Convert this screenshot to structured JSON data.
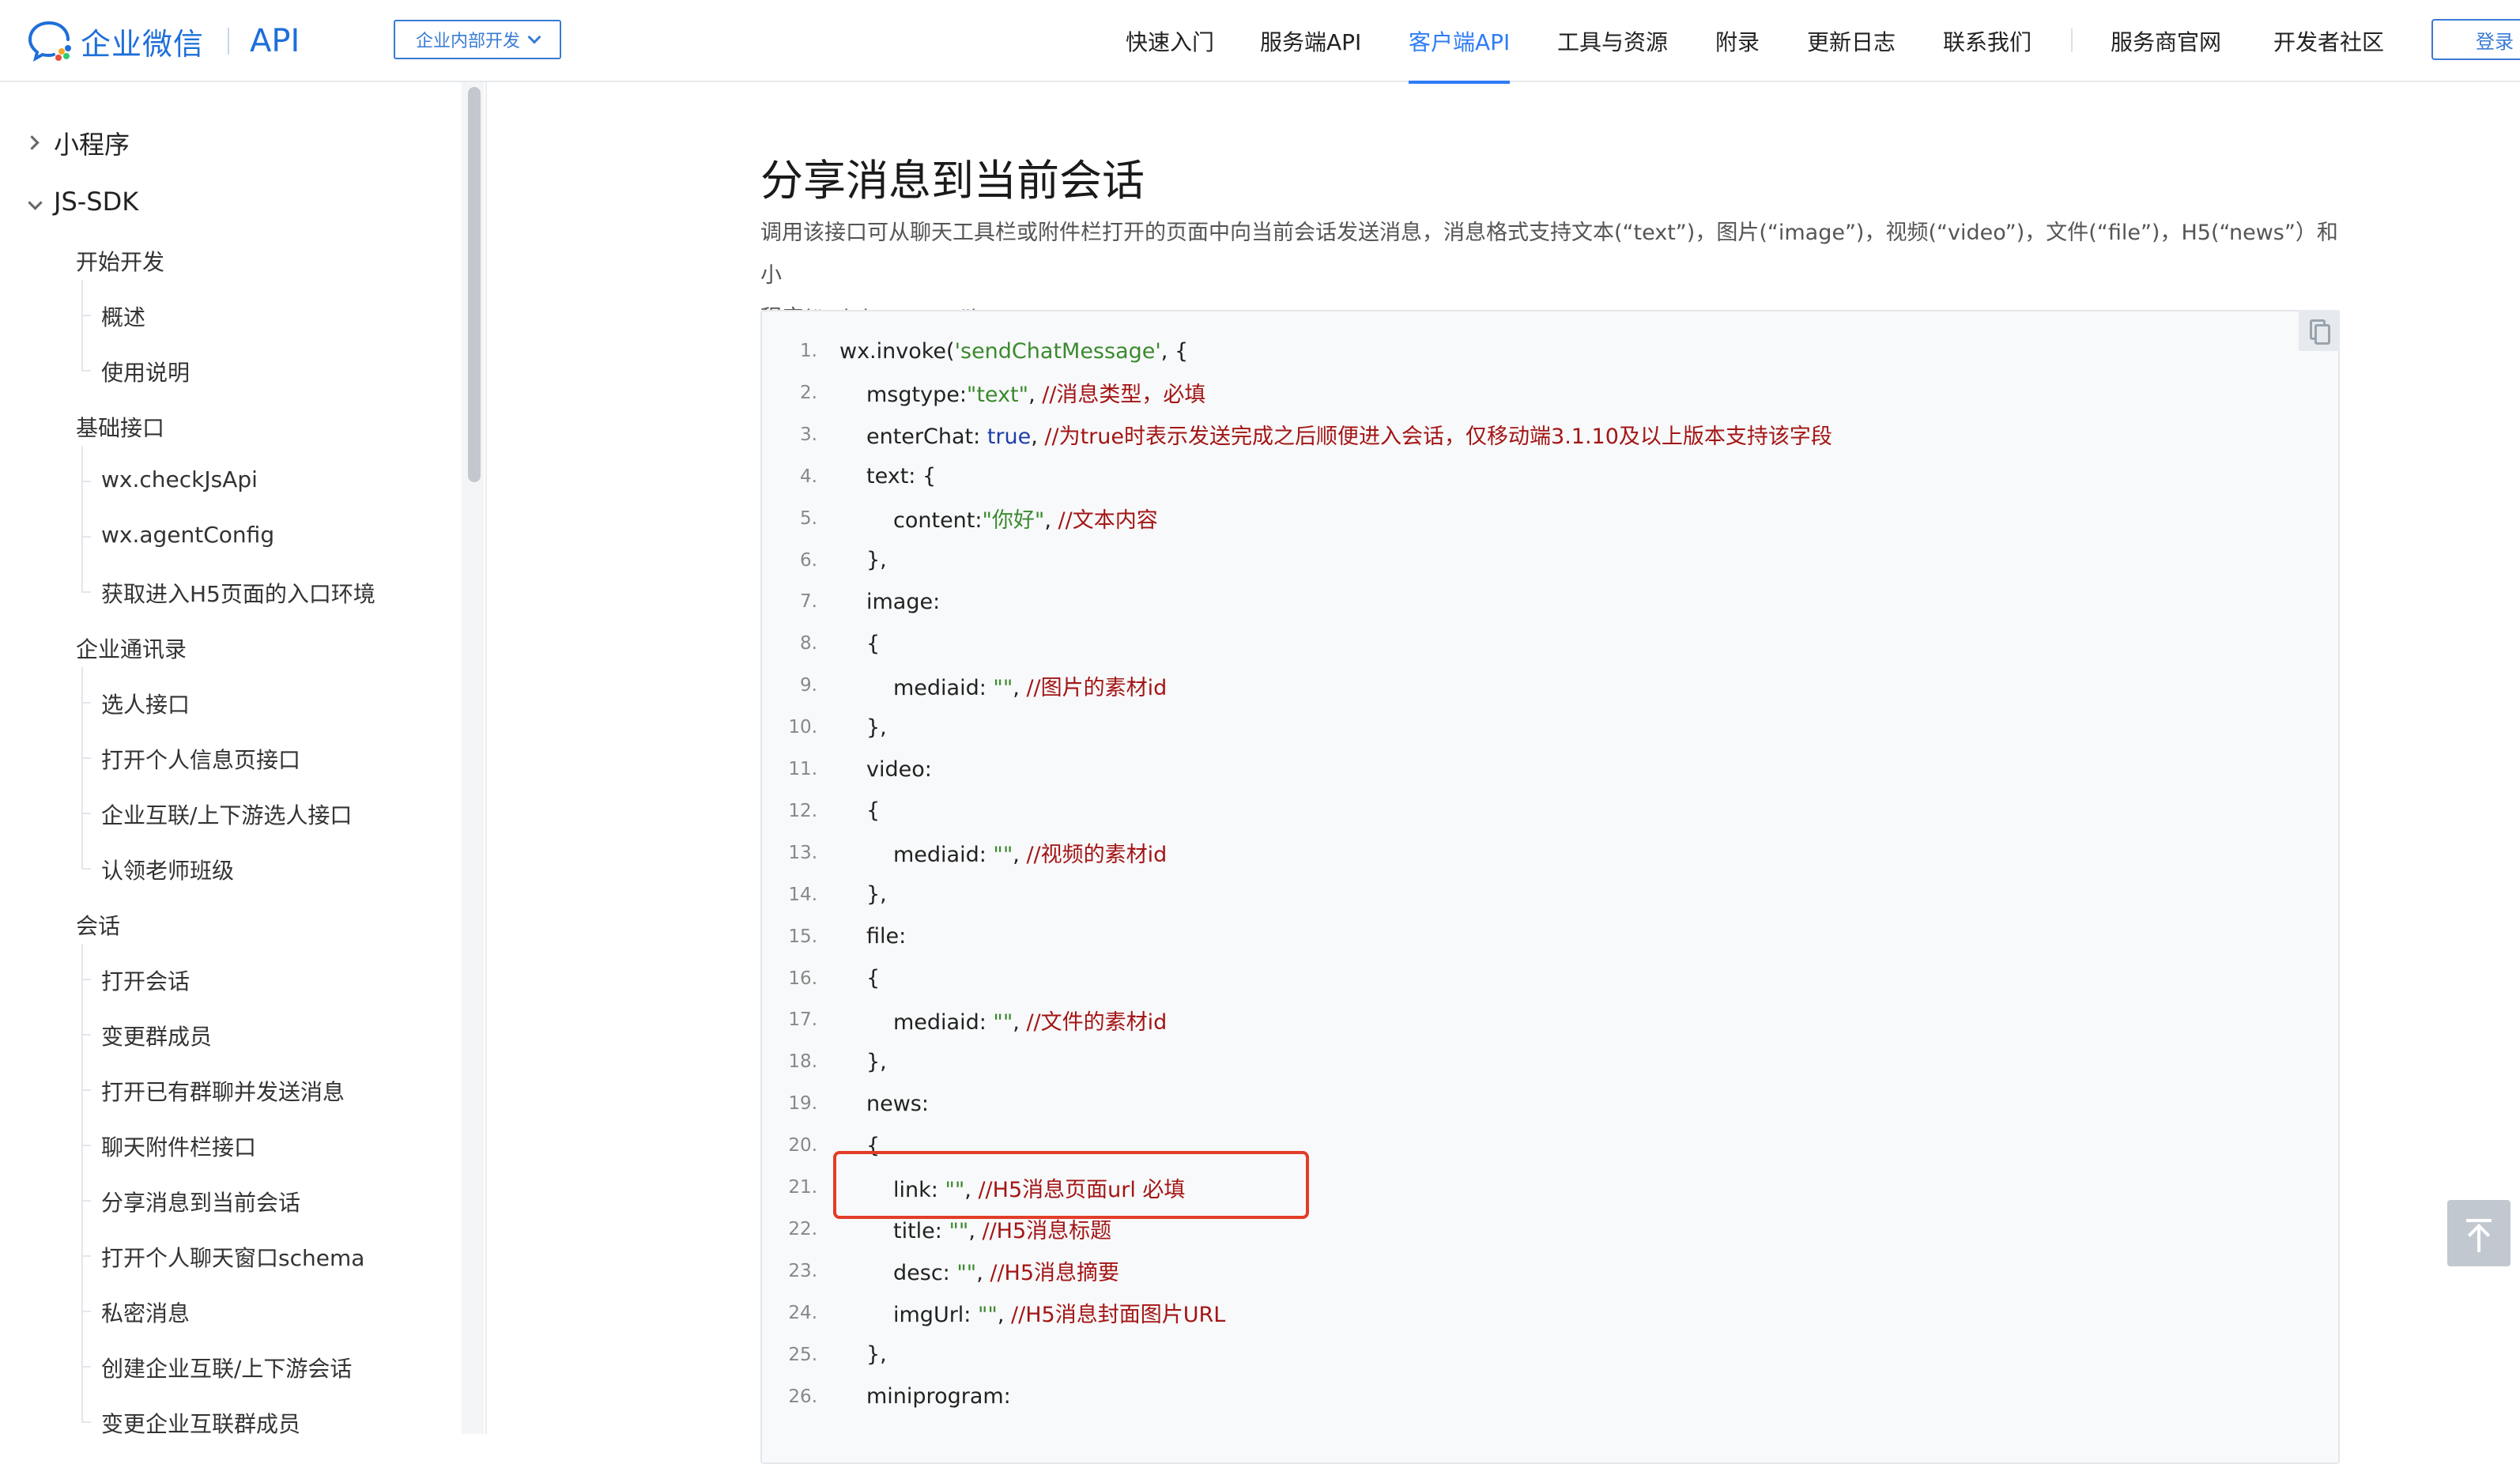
{
  "header": {
    "logo_text": "企业微信",
    "logo_api": "API",
    "dev_select": "企业内部开发",
    "nav": [
      {
        "label": "快速入门"
      },
      {
        "label": "服务端API"
      },
      {
        "label": "客户端API",
        "active": true
      },
      {
        "label": "工具与资源"
      },
      {
        "label": "附录"
      },
      {
        "label": "更新日志"
      },
      {
        "label": "联系我们"
      },
      {
        "label": "服务商官网"
      },
      {
        "label": "开发者社区"
      }
    ],
    "login": "登录",
    "accent_color": "#2f7cf6"
  },
  "sidebar": {
    "top": [
      {
        "label": "小程序",
        "expanded": false
      },
      {
        "label": "JS-SDK",
        "expanded": true
      }
    ],
    "groups": [
      {
        "label": "开始开发",
        "items": [
          "概述",
          "使用说明"
        ]
      },
      {
        "label": "基础接口",
        "items": [
          "wx.checkJsApi",
          "wx.agentConfig",
          "获取进入H5页面的入口环境"
        ]
      },
      {
        "label": "企业通讯录",
        "items": [
          "选人接口",
          "打开个人信息页接口",
          "企业互联/上下游选人接口",
          "认领老师班级"
        ]
      },
      {
        "label": "会话",
        "items": [
          "打开会话",
          "变更群成员",
          "打开已有群聊并发送消息",
          "聊天附件栏接口",
          "分享消息到当前会话",
          "打开个人聊天窗口schema",
          "私密消息",
          "创建企业互联/上下游会话",
          "变更企业互联群成员"
        ]
      }
    ]
  },
  "main": {
    "title": "分享消息到当前会话",
    "desc_line1": "调用该接口可从聊天工具栏或附件栏打开的页面中向当前会话发送消息，消息格式支持文本(“text”)，图片(“image”)，视频(“video”)，文件(“file”)，H5(“news”）和小",
    "desc_line2": "程序(“miniprogram”)"
  },
  "code": [
    {
      "n": "1.",
      "indent": 0,
      "parts": [
        [
          "k",
          "wx.invoke("
        ],
        [
          "s",
          "'sendChatMessage'"
        ],
        [
          "p",
          ", {"
        ]
      ]
    },
    {
      "n": "2.",
      "indent": 1,
      "parts": [
        [
          "k",
          "msgtype:"
        ],
        [
          "s",
          "\"text\""
        ],
        [
          "p",
          ", "
        ],
        [
          "c",
          "//消息类型，必填"
        ]
      ]
    },
    {
      "n": "3.",
      "indent": 1,
      "parts": [
        [
          "k",
          "enterChat: "
        ],
        [
          "b",
          "true"
        ],
        [
          "p",
          ", "
        ],
        [
          "c",
          "//为true时表示发送完成之后顺便进入会话，仅移动端3.1.10及以上版本支持该字段"
        ]
      ]
    },
    {
      "n": "4.",
      "indent": 1,
      "parts": [
        [
          "k",
          "text: {"
        ]
      ]
    },
    {
      "n": "5.",
      "indent": 2,
      "parts": [
        [
          "k",
          "content:"
        ],
        [
          "s",
          "\"你好\""
        ],
        [
          "p",
          ", "
        ],
        [
          "c",
          "//文本内容"
        ]
      ]
    },
    {
      "n": "6.",
      "indent": 1,
      "parts": [
        [
          "p",
          "},"
        ]
      ]
    },
    {
      "n": "7.",
      "indent": 1,
      "parts": [
        [
          "k",
          "image:"
        ]
      ]
    },
    {
      "n": "8.",
      "indent": 1,
      "parts": [
        [
          "p",
          "{"
        ]
      ]
    },
    {
      "n": "9.",
      "indent": 2,
      "parts": [
        [
          "k",
          "mediaid: "
        ],
        [
          "s",
          "\"\""
        ],
        [
          "p",
          ", "
        ],
        [
          "c",
          "//图片的素材id"
        ]
      ]
    },
    {
      "n": "10.",
      "indent": 1,
      "parts": [
        [
          "p",
          "},"
        ]
      ]
    },
    {
      "n": "11.",
      "indent": 1,
      "parts": [
        [
          "k",
          "video:"
        ]
      ]
    },
    {
      "n": "12.",
      "indent": 1,
      "parts": [
        [
          "p",
          "{"
        ]
      ]
    },
    {
      "n": "13.",
      "indent": 2,
      "parts": [
        [
          "k",
          "mediaid: "
        ],
        [
          "s",
          "\"\""
        ],
        [
          "p",
          ", "
        ],
        [
          "c",
          "//视频的素材id"
        ]
      ]
    },
    {
      "n": "14.",
      "indent": 1,
      "parts": [
        [
          "p",
          "},"
        ]
      ]
    },
    {
      "n": "15.",
      "indent": 1,
      "parts": [
        [
          "k",
          "file:"
        ]
      ]
    },
    {
      "n": "16.",
      "indent": 1,
      "parts": [
        [
          "p",
          "{"
        ]
      ]
    },
    {
      "n": "17.",
      "indent": 2,
      "parts": [
        [
          "k",
          "mediaid: "
        ],
        [
          "s",
          "\"\""
        ],
        [
          "p",
          ", "
        ],
        [
          "c",
          "//文件的素材id"
        ]
      ]
    },
    {
      "n": "18.",
      "indent": 1,
      "parts": [
        [
          "p",
          "},"
        ]
      ]
    },
    {
      "n": "19.",
      "indent": 1,
      "parts": [
        [
          "k",
          "news:"
        ]
      ]
    },
    {
      "n": "20.",
      "indent": 1,
      "parts": [
        [
          "p",
          "{"
        ]
      ]
    },
    {
      "n": "21.",
      "indent": 2,
      "parts": [
        [
          "k",
          "link: "
        ],
        [
          "s",
          "\"\""
        ],
        [
          "p",
          ", "
        ],
        [
          "c",
          "//H5消息页面url 必填"
        ]
      ]
    },
    {
      "n": "22.",
      "indent": 2,
      "parts": [
        [
          "k",
          "title: "
        ],
        [
          "s",
          "\"\""
        ],
        [
          "p",
          ", "
        ],
        [
          "c",
          "//H5消息标题"
        ]
      ]
    },
    {
      "n": "23.",
      "indent": 2,
      "parts": [
        [
          "k",
          "desc: "
        ],
        [
          "s",
          "\"\""
        ],
        [
          "p",
          ", "
        ],
        [
          "c",
          "//H5消息摘要"
        ]
      ]
    },
    {
      "n": "24.",
      "indent": 2,
      "parts": [
        [
          "k",
          "imgUrl: "
        ],
        [
          "s",
          "\"\""
        ],
        [
          "p",
          ", "
        ],
        [
          "c",
          "//H5消息封面图片URL"
        ]
      ]
    },
    {
      "n": "25.",
      "indent": 1,
      "parts": [
        [
          "p",
          "},"
        ]
      ]
    },
    {
      "n": "26.",
      "indent": 1,
      "parts": [
        [
          "k",
          "miniprogram:"
        ]
      ]
    }
  ]
}
